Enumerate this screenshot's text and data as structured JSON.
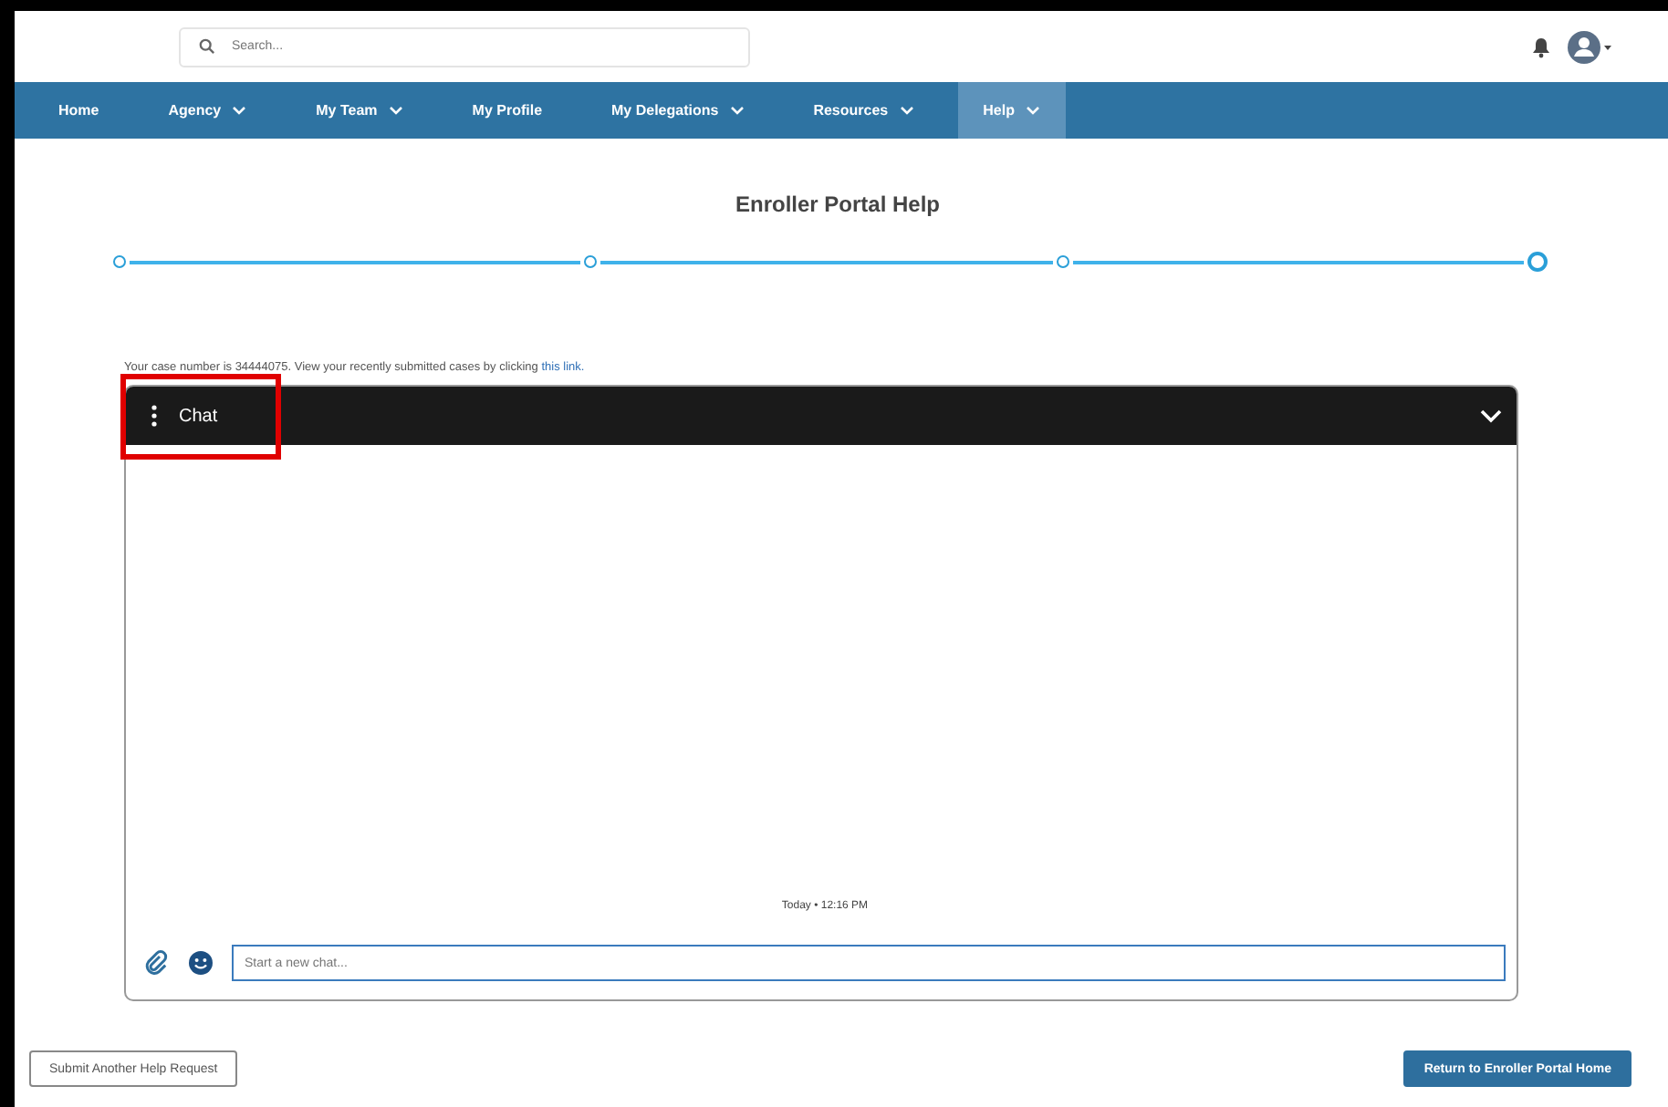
{
  "header": {
    "search": {
      "placeholder": "Search..."
    }
  },
  "nav": [
    {
      "label": "Home",
      "has_menu": false,
      "selected": false
    },
    {
      "label": "Agency",
      "has_menu": true,
      "selected": false
    },
    {
      "label": "My Team",
      "has_menu": true,
      "selected": false
    },
    {
      "label": "My Profile",
      "has_menu": false,
      "selected": false
    },
    {
      "label": "My Delegations",
      "has_menu": true,
      "selected": false
    },
    {
      "label": "Resources",
      "has_menu": true,
      "selected": false
    },
    {
      "label": "Help",
      "has_menu": true,
      "selected": true
    }
  ],
  "page_title": "Enroller Portal Help",
  "stepper": [
    {
      "current": false
    },
    {
      "current": false
    },
    {
      "current": false
    },
    {
      "current": true
    }
  ],
  "case_text": "Your case number is 34444075. View your recently submitted cases by clicking ",
  "case_link": "this link.",
  "chat": {
    "title": "Chat",
    "highlighted": true,
    "timestamp": "Today • 12:16 PM",
    "input": {
      "placeholder": "Start a new chat..."
    }
  },
  "buttons": [
    {
      "label": "Submit Another Help Request",
      "kind": "outline"
    },
    {
      "label": "Return to Enroller Portal Home",
      "kind": "primary"
    }
  ]
}
